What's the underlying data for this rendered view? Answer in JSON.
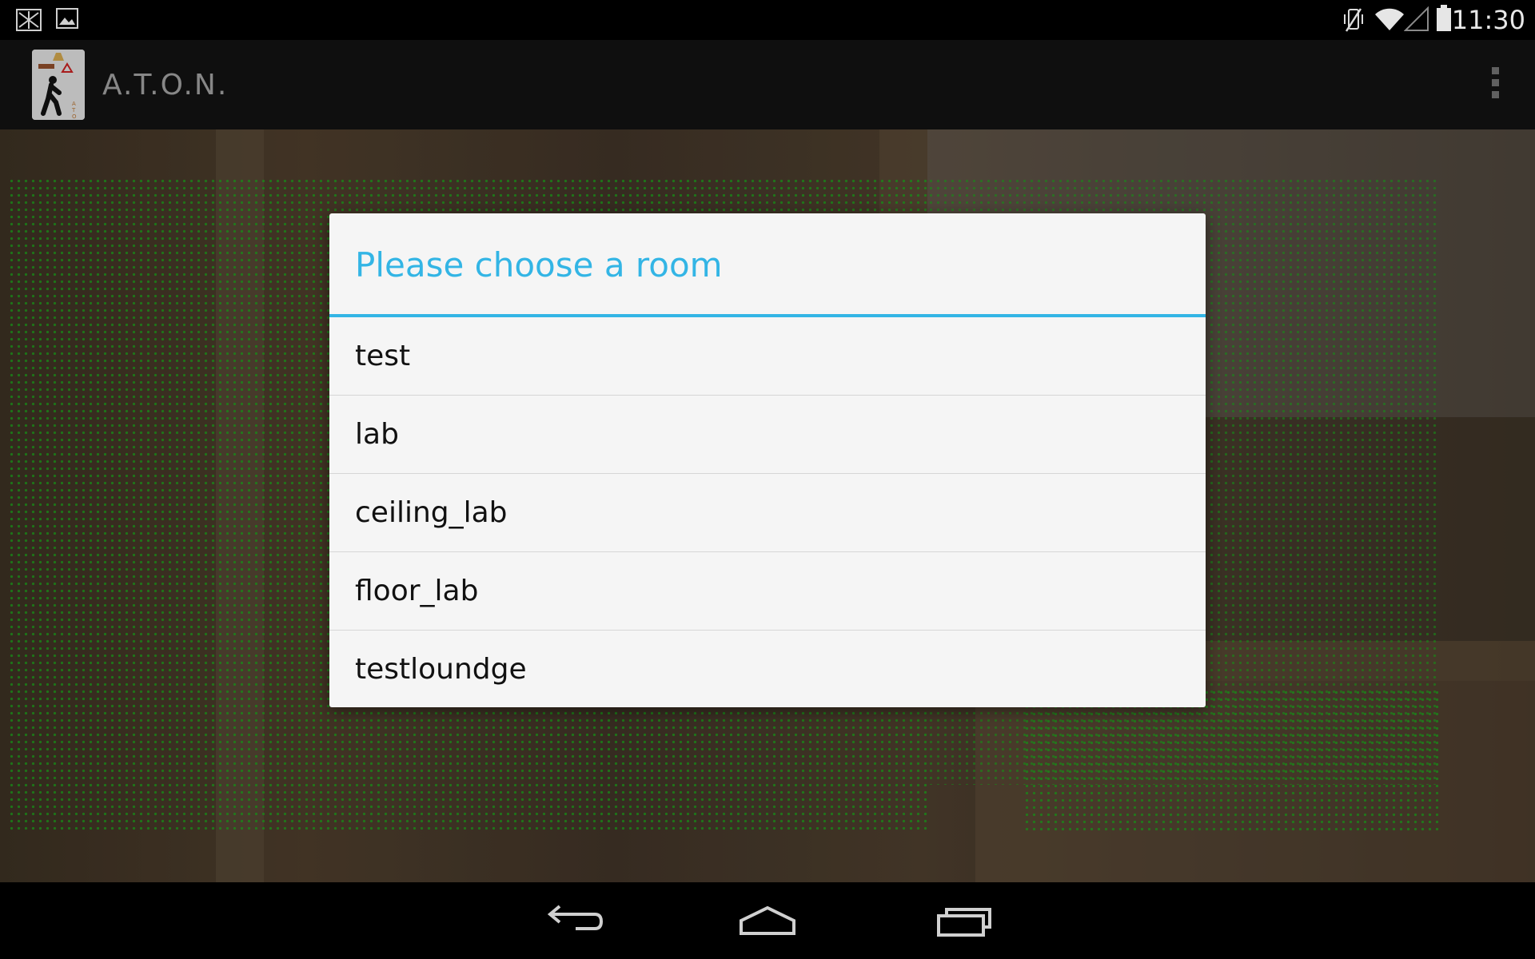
{
  "status_bar": {
    "left_icons": [
      "notification-app-icon",
      "image-icon"
    ],
    "right_icons": [
      "vibrate-off-icon",
      "wifi-icon",
      "signal-icon",
      "battery-icon"
    ],
    "time": "11:30"
  },
  "action_bar": {
    "app_icon": "aton-pedestrian-icon",
    "title": "A.T.O.N.",
    "overflow_icon": "overflow-menu-icon"
  },
  "dialog": {
    "title": "Please choose a room",
    "accent_color": "#33b5e5",
    "rooms": [
      "test",
      "lab",
      "ceiling_lab",
      "floor_lab",
      "testloundge"
    ]
  },
  "nav_bar": {
    "buttons": [
      "back-icon",
      "home-icon",
      "recent-apps-icon"
    ]
  }
}
